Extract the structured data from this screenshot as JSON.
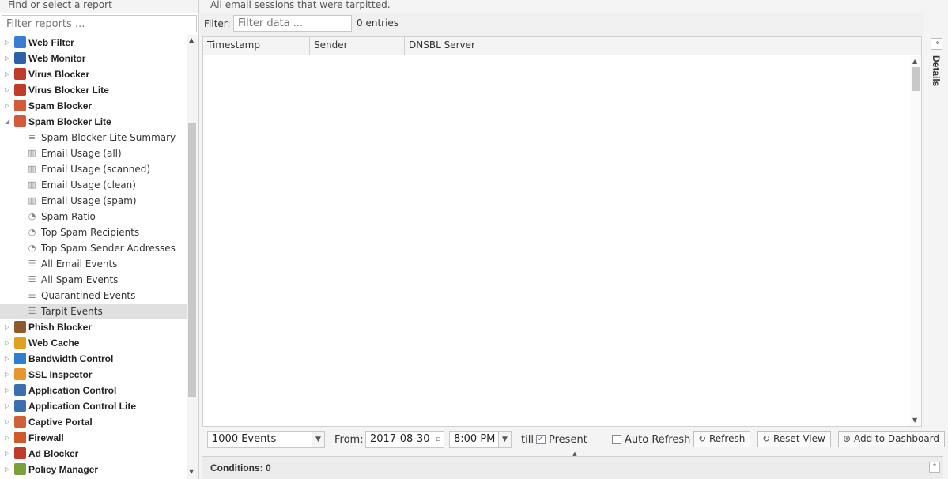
{
  "left": {
    "header": "Find or select a report",
    "filter_placeholder": "Filter reports ...",
    "apps": [
      {
        "name": "Web Filter",
        "color": "#3a7bd5",
        "expanded": false
      },
      {
        "name": "Web Monitor",
        "color": "#2f5fa8",
        "expanded": false
      },
      {
        "name": "Virus Blocker",
        "color": "#c0392b",
        "expanded": false
      },
      {
        "name": "Virus Blocker Lite",
        "color": "#c0392b",
        "expanded": false
      },
      {
        "name": "Spam Blocker",
        "color": "#d35b3a",
        "expanded": false
      },
      {
        "name": "Spam Blocker Lite",
        "color": "#d35b3a",
        "expanded": true,
        "reports": [
          {
            "name": "Spam Blocker Lite Summary",
            "icon": "text-icon"
          },
          {
            "name": "Email Usage (all)",
            "icon": "bar-chart-icon"
          },
          {
            "name": "Email Usage (scanned)",
            "icon": "bar-chart-icon"
          },
          {
            "name": "Email Usage (clean)",
            "icon": "bar-chart-icon"
          },
          {
            "name": "Email Usage (spam)",
            "icon": "bar-chart-icon"
          },
          {
            "name": "Spam Ratio",
            "icon": "pie-chart-icon"
          },
          {
            "name": "Top Spam Recipients",
            "icon": "pie-chart-icon"
          },
          {
            "name": "Top Spam Sender Addresses",
            "icon": "pie-chart-icon"
          },
          {
            "name": "All Email Events",
            "icon": "list-icon"
          },
          {
            "name": "All Spam Events",
            "icon": "list-icon"
          },
          {
            "name": "Quarantined Events",
            "icon": "list-icon"
          },
          {
            "name": "Tarpit Events",
            "icon": "list-icon",
            "selected": true
          }
        ]
      },
      {
        "name": "Phish Blocker",
        "color": "#8e5a2b",
        "expanded": false
      },
      {
        "name": "Web Cache",
        "color": "#e0a020",
        "expanded": false
      },
      {
        "name": "Bandwidth Control",
        "color": "#2f7fd0",
        "expanded": false
      },
      {
        "name": "SSL Inspector",
        "color": "#e8962b",
        "expanded": false
      },
      {
        "name": "Application Control",
        "color": "#3d6fb0",
        "expanded": false
      },
      {
        "name": "Application Control Lite",
        "color": "#3d6fb0",
        "expanded": false
      },
      {
        "name": "Captive Portal",
        "color": "#d0603a",
        "expanded": false
      },
      {
        "name": "Firewall",
        "color": "#d05a2a",
        "expanded": false
      },
      {
        "name": "Ad Blocker",
        "color": "#c0392b",
        "expanded": false
      },
      {
        "name": "Policy Manager",
        "color": "#7aa03a",
        "expanded": false
      }
    ]
  },
  "description": "All email sessions that were tarpitted.",
  "filter": {
    "label": "Filter:",
    "placeholder": "Filter data ...",
    "count": "0 entries"
  },
  "grid": {
    "columns": [
      "Timestamp",
      "Sender",
      "DNSBL Server"
    ]
  },
  "details_label": "Details",
  "toolbar": {
    "events": "1000 Events",
    "from_label": "From:",
    "date": "2017-08-30",
    "time": "8:00 PM",
    "till_label": "till",
    "present_label": "Present",
    "present_checked": true,
    "auto_refresh_label": "Auto Refresh",
    "auto_refresh_checked": false,
    "refresh_label": "Refresh",
    "reset_view_label": "Reset View",
    "add_dashboard_label": "Add to Dashboard"
  },
  "conditions": "Conditions: 0"
}
